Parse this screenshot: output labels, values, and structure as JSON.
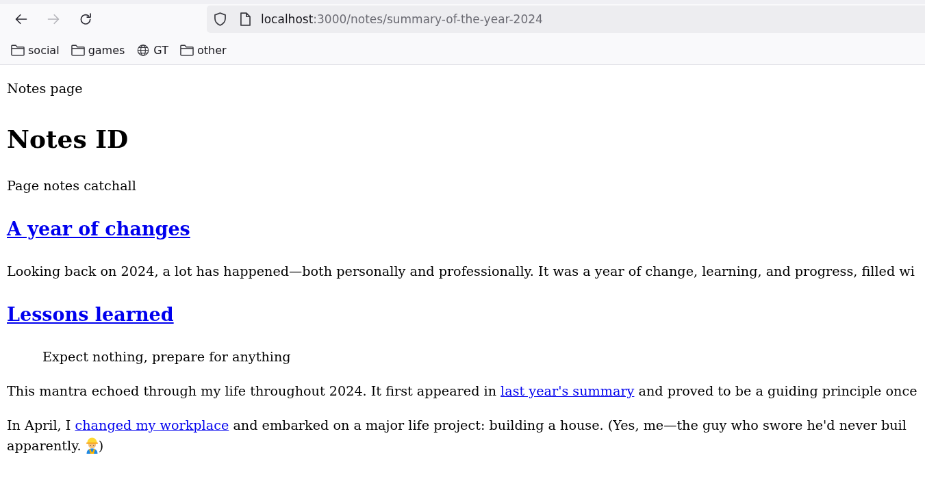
{
  "browser": {
    "nav_buttons": [
      {
        "kind": "back",
        "disabled": false
      },
      {
        "kind": "forward",
        "disabled": true
      },
      {
        "kind": "reload",
        "disabled": false
      }
    ],
    "address_bar": {
      "host": "localhost",
      "path": ":3000/notes/summary-of-the-year-2024"
    },
    "bookmarks": [
      {
        "kind": "folder",
        "label": "social"
      },
      {
        "kind": "folder",
        "label": "games"
      },
      {
        "kind": "site",
        "label": "GT"
      },
      {
        "kind": "folder",
        "label": "other"
      }
    ]
  },
  "page": {
    "blocks": [
      {
        "kind": "paragraph",
        "lines": [
          [
            {
              "kind": "text",
              "text": "Notes page"
            }
          ]
        ]
      },
      {
        "kind": "title",
        "text": "Notes ID"
      },
      {
        "kind": "paragraph",
        "lines": [
          [
            {
              "kind": "text",
              "text": "Page notes catchall"
            }
          ]
        ]
      },
      {
        "kind": "section_heading",
        "text": "A year of changes"
      },
      {
        "kind": "paragraph",
        "lines": [
          [
            {
              "kind": "text",
              "text": "Looking back on 2024, a lot has happened—both personally and professionally. It was a year of change, learning, and progress, filled wi"
            }
          ]
        ]
      },
      {
        "kind": "section_heading",
        "text": "Lessons learned"
      },
      {
        "kind": "quote",
        "text": "Expect nothing, prepare for anything"
      },
      {
        "kind": "paragraph",
        "lines": [
          [
            {
              "kind": "text",
              "text": "This mantra echoed through my life throughout 2024. It first appeared in "
            },
            {
              "kind": "link",
              "text": "last year's summary"
            },
            {
              "kind": "text",
              "text": " and proved to be a guiding principle once"
            }
          ]
        ]
      },
      {
        "kind": "paragraph",
        "lines": [
          [
            {
              "kind": "text",
              "text": "In April, I "
            },
            {
              "kind": "link",
              "text": "changed my workplace"
            },
            {
              "kind": "text",
              "text": " and embarked on a major life project: building a house. (Yes, me—the guy who swore he'd never buil"
            }
          ],
          [
            {
              "kind": "text",
              "text": "apparently. "
            },
            {
              "kind": "emoji"
            },
            {
              "kind": "text",
              "text": ")"
            }
          ]
        ]
      }
    ]
  }
}
